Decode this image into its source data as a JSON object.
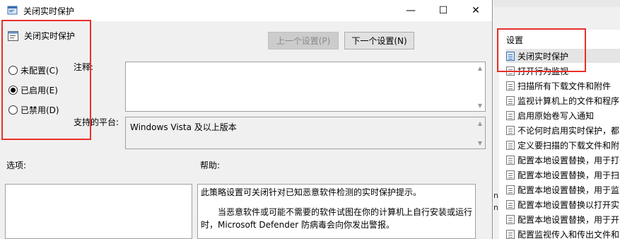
{
  "window": {
    "title": "关闭实时保护",
    "minimize_glyph": "—",
    "maximize_glyph": "☐",
    "close_glyph": "✕"
  },
  "header": {
    "title": "关闭实时保护"
  },
  "nav": {
    "prev_label": "上一个设置(P)",
    "next_label": "下一个设置(N)"
  },
  "options": {
    "not_configured": "未配置(C)",
    "enabled": "已启用(E)",
    "disabled": "已禁用(D)",
    "selected": "enabled"
  },
  "comment": {
    "label": "注释:",
    "value": ""
  },
  "platform": {
    "label": "支持的平台:",
    "value": "Windows Vista 及以上版本"
  },
  "options_section": {
    "label": "选项:"
  },
  "help_section": {
    "label": "帮助:",
    "paragraph1": "此策略设置可关闭针对已知恶意软件检测的实时保护提示。",
    "paragraph2": "当恶意软件或可能不需要的软件试图在你的计算机上自行安装或运行时，Microsoft Defender 防病毒会向你发出警报。"
  },
  "settings_panel": {
    "heading": "设置",
    "left_marks": [
      "n",
      "n"
    ],
    "items": [
      "关闭实时保护",
      "打开行为监视",
      "扫描所有下载文件和附件",
      "监视计算机上的文件和程序",
      "启用原始卷写入通知",
      "不论何时启用实时保护，都",
      "定义要扫描的下载文件和附",
      "配置本地设置替换，用于打开",
      "配置本地设置替换，用于扫",
      "配置本地设置替换，用于监",
      "配置本地设置替换以打开实",
      "配置本地设置替换，用于开",
      "配置监视传入和传出文件和"
    ],
    "selected_index": 0
  },
  "colors": {
    "highlight_border": "#e8302a",
    "dialog_bg": "#f0f0f0",
    "selected_item_bg": "#e5e5e5"
  }
}
